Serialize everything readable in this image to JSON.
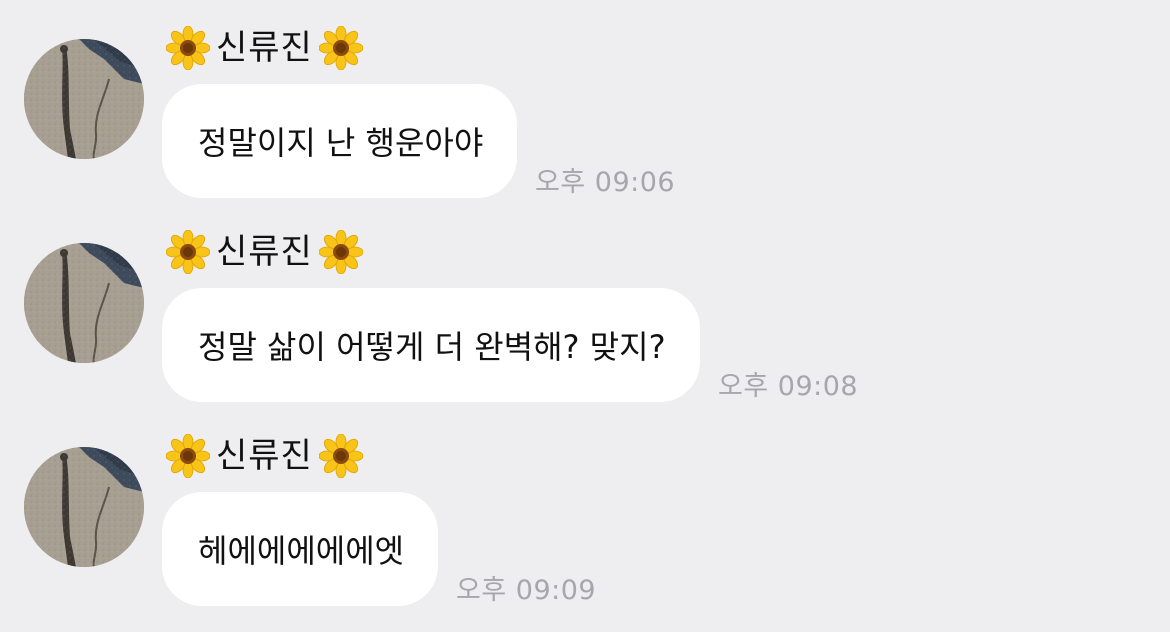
{
  "messages": [
    {
      "sender": "신류진",
      "sender_decoration": "sunflower-icon",
      "text": "정말이지 난 행운아야",
      "time": "오후 09:06"
    },
    {
      "sender": "신류진",
      "sender_decoration": "sunflower-icon",
      "text": "정말 삶이 어떻게 더 완벽해? 맞지?",
      "time": "오후 09:08"
    },
    {
      "sender": "신류진",
      "sender_decoration": "sunflower-icon",
      "text": "헤에에에에에엣",
      "time": "오후 09:09"
    }
  ],
  "colors": {
    "background": "#eeeef0",
    "bubble": "#ffffff",
    "text": "#111111",
    "timestamp": "#a7a7ab"
  }
}
